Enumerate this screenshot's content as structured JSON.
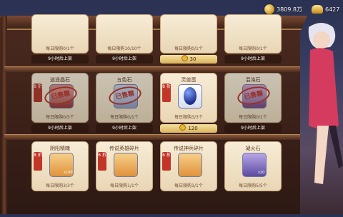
{
  "currencies": [
    {
      "icon": "gold-coin-icon",
      "value": "3809.8万"
    },
    {
      "icon": "gold-ingot-icon",
      "value": "6427"
    }
  ],
  "top_row": {
    "limits": [
      "每日限购0/1个",
      "每日限购10/10个",
      "每日限购0/1个",
      "每日限购0/1个"
    ],
    "timers": [
      "9小时后上架",
      "9小时后上架",
      "9小时后上架"
    ],
    "price": "30"
  },
  "middle_row": [
    {
      "name": "逍遥晶石",
      "discount": "8\n折",
      "stamp": "已售罄",
      "limit": "每日限购0/5个",
      "timer": "9小时后上架"
    },
    {
      "name": "五色石",
      "discount": "",
      "stamp": "已售罄",
      "limit": "每日限购0/1个",
      "timer": "9小时后上架"
    },
    {
      "name": "灵兽蛋",
      "discount": "8\n折",
      "stamp": "",
      "limit": "每日限购3/3个",
      "price": "120"
    },
    {
      "name": "混沌石",
      "discount": "",
      "stamp": "已售罄",
      "limit": "每日限购0/1个",
      "timer": "9小时后上架"
    }
  ],
  "bottom_row": [
    {
      "name": "阴阳精魄",
      "discount": "8\n折",
      "qty": "x100",
      "limit": "每日限购3/3个"
    },
    {
      "name": "传说英雄碎片",
      "discount": "6\n折",
      "qty": "",
      "limit": "每日限购1/1个"
    },
    {
      "name": "传说神兵碎片",
      "discount": "6\n折",
      "qty": "",
      "limit": "每日限购1/1个"
    },
    {
      "name": "凝火石",
      "discount": "",
      "qty": "x20",
      "limit": "每日限购5/5个"
    }
  ]
}
